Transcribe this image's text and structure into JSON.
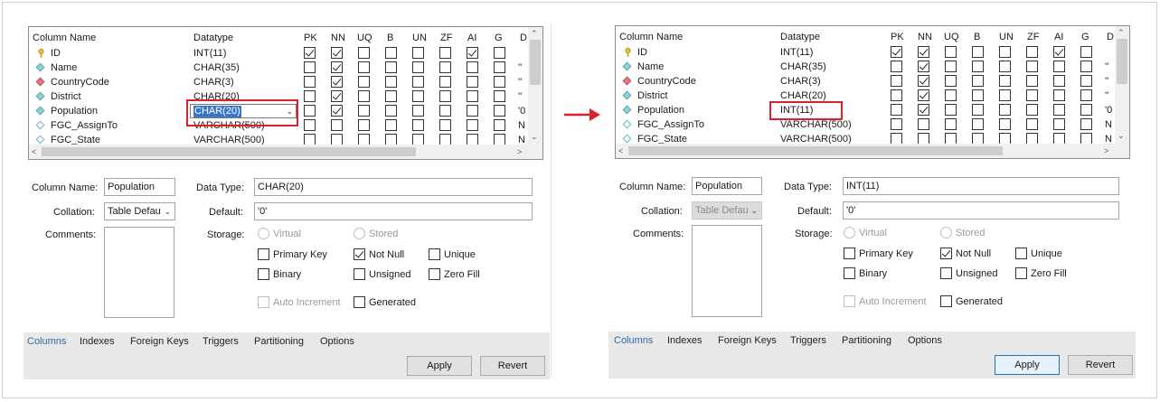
{
  "grid": {
    "headers": {
      "name": "Column Name",
      "datatype": "Datatype",
      "pk": "PK",
      "nn": "NN",
      "uq": "UQ",
      "b": "B",
      "un": "UN",
      "zf": "ZF",
      "ai": "AI",
      "g": "G",
      "d": "D"
    }
  },
  "left": {
    "rows": [
      {
        "name": "ID",
        "type": "INT(11)",
        "default": ""
      },
      {
        "name": "Name",
        "type": "CHAR(35)",
        "default": "''"
      },
      {
        "name": "CountryCode",
        "type": "CHAR(3)",
        "default": "''"
      },
      {
        "name": "District",
        "type": "CHAR(20)",
        "default": "''"
      },
      {
        "name": "Population",
        "type": "CHAR(20)",
        "default": "'0"
      },
      {
        "name": "FGC_AssignTo",
        "type": "VARCHAR(500)",
        "default": "N"
      },
      {
        "name": "FGC_State",
        "type": "VARCHAR(500)",
        "default": "N"
      }
    ],
    "details": {
      "column_name_label": "Column Name:",
      "column_name_value": "Population",
      "collation_label": "Collation:",
      "collation_value": "Table Defau",
      "comments_label": "Comments:",
      "data_type_label": "Data Type:",
      "data_type_value": "CHAR(20)",
      "default_label": "Default:",
      "default_value": "'0'",
      "storage_label": "Storage:",
      "virtual": "Virtual",
      "stored": "Stored",
      "primary_key": "Primary Key",
      "not_null": "Not Null",
      "unique": "Unique",
      "binary": "Binary",
      "unsigned": "Unsigned",
      "zero_fill": "Zero Fill",
      "auto_increment": "Auto Increment",
      "generated": "Generated"
    }
  },
  "right": {
    "rows": [
      {
        "name": "ID",
        "type": "INT(11)",
        "default": ""
      },
      {
        "name": "Name",
        "type": "CHAR(35)",
        "default": "''"
      },
      {
        "name": "CountryCode",
        "type": "CHAR(3)",
        "default": "''"
      },
      {
        "name": "District",
        "type": "CHAR(20)",
        "default": "''"
      },
      {
        "name": "Population",
        "type": "INT(11)",
        "default": "'0"
      },
      {
        "name": "FGC_AssignTo",
        "type": "VARCHAR(500)",
        "default": "N"
      },
      {
        "name": "FGC_State",
        "type": "VARCHAR(500)",
        "default": "N"
      }
    ],
    "details": {
      "column_name_label": "Column Name:",
      "column_name_value": "Population",
      "collation_label": "Collation:",
      "collation_value": "Table Defau",
      "comments_label": "Comments:",
      "data_type_label": "Data Type:",
      "data_type_value": "INT(11)",
      "default_label": "Default:",
      "default_value": "'0'",
      "storage_label": "Storage:",
      "virtual": "Virtual",
      "stored": "Stored",
      "primary_key": "Primary Key",
      "not_null": "Not Null",
      "unique": "Unique",
      "binary": "Binary",
      "unsigned": "Unsigned",
      "zero_fill": "Zero Fill",
      "auto_increment": "Auto Increment",
      "generated": "Generated"
    }
  },
  "tabs": [
    "Columns",
    "Indexes",
    "Foreign Keys",
    "Triggers",
    "Partitioning",
    "Options"
  ],
  "buttons": {
    "apply": "Apply",
    "revert": "Revert"
  },
  "colors": {
    "highlight": "#d9202c",
    "active_tab": "#2f6aa8"
  }
}
